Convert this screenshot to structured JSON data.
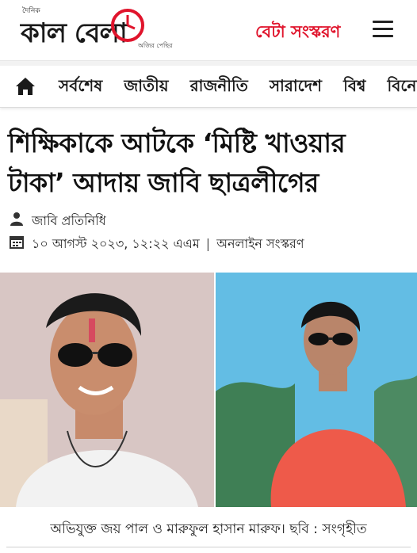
{
  "header": {
    "logo_small_text": "দৈনিক",
    "logo_text": "কাল বেলা",
    "logo_tagline": "অজির পেছির",
    "beta_label": "বেটা সংস্করণ"
  },
  "nav": {
    "items": [
      "সর্বশেষ",
      "জাতীয়",
      "রাজনীতি",
      "সারাদেশ",
      "বিশ্ব",
      "বিনোদন"
    ]
  },
  "article": {
    "headline_line1": "শিক্ষিকাকে আটকে ‘মিষ্টি খাওয়ার",
    "headline_line2": "টাকা’ আদায় জাবি ছাত্রলীগের",
    "author": "জাবি প্রতিনিধি",
    "date": "১০ আগস্ট ২০২৩, ১২:২২ এএম",
    "separator": "|",
    "edition": "অনলাইন সংস্করণ",
    "caption": "অভিযুক্ত জয় পাল ও মারুফুল হাসান মারুফ। ছবি : সংগৃহীত"
  },
  "colors": {
    "brand_red": "#e0142c",
    "text_dark": "#111111"
  },
  "icons": {
    "home": "home-icon",
    "menu": "hamburger-menu-icon",
    "author": "user-icon",
    "date": "calendar-icon"
  }
}
